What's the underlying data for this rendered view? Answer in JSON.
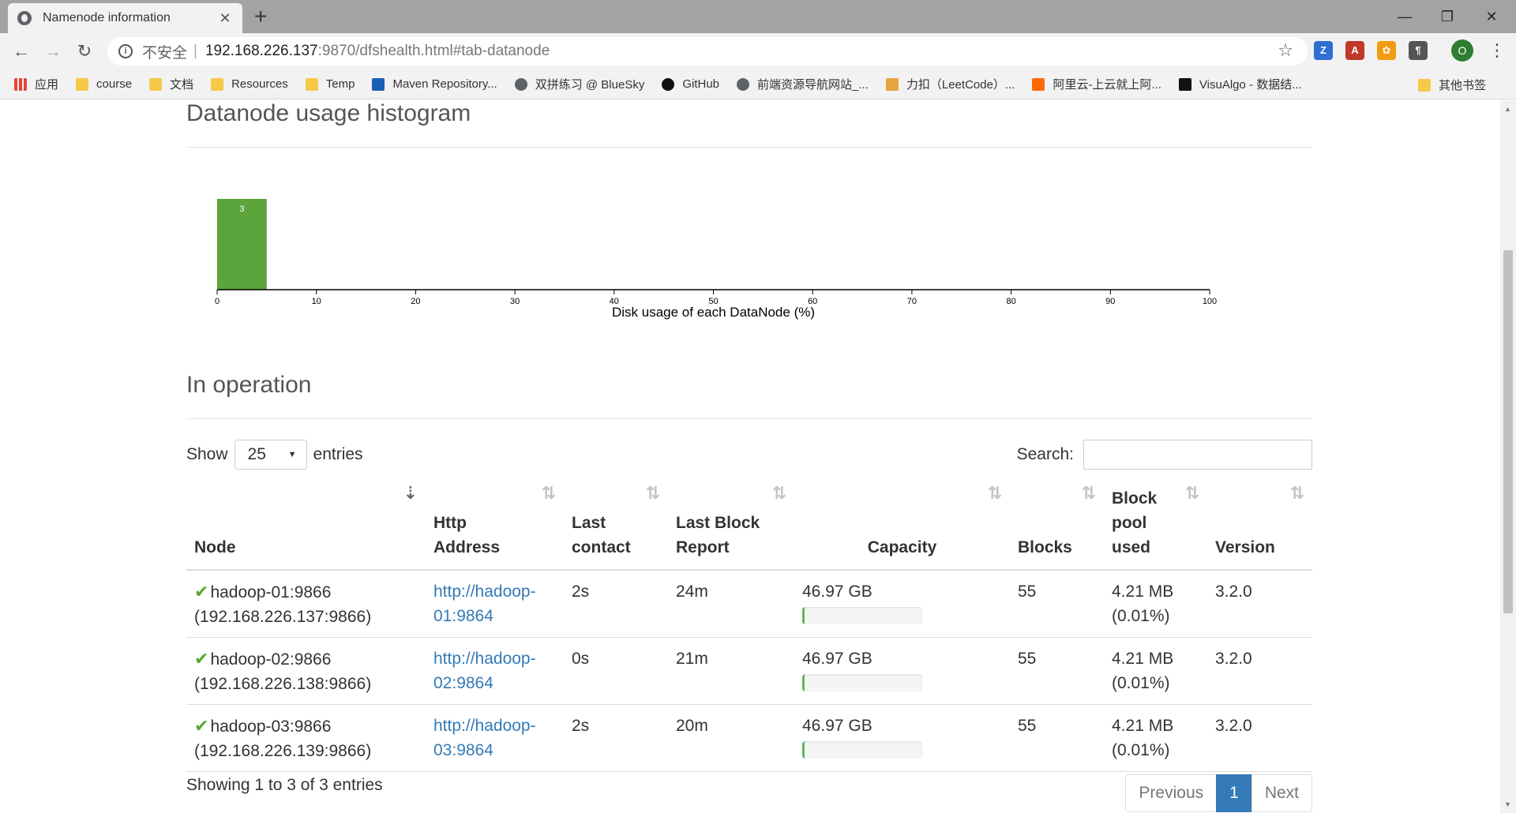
{
  "browser": {
    "tab_title": "Namenode information",
    "address": {
      "insecure_label": "不安全",
      "host": "192.168.226.137",
      "rest": ":9870/dfshealth.html#tab-datanode"
    },
    "profile_initial": "O",
    "bookmarks": [
      {
        "label": "应用",
        "icon": "apps-icon"
      },
      {
        "label": "course",
        "icon": "folder-icon"
      },
      {
        "label": "文档",
        "icon": "folder-icon"
      },
      {
        "label": "Resources",
        "icon": "folder-icon"
      },
      {
        "label": "Temp",
        "icon": "folder-icon"
      },
      {
        "label": "Maven Repository...",
        "icon": "maven-icon"
      },
      {
        "label": "双拼练习 @ BlueSky",
        "icon": "globe-icon"
      },
      {
        "label": "GitHub",
        "icon": "github-icon"
      },
      {
        "label": "前端资源导航网站_...",
        "icon": "globe-icon"
      },
      {
        "label": "力扣（LeetCode）...",
        "icon": "leetcode-icon"
      },
      {
        "label": "阿里云-上云就上阿...",
        "icon": "aliyun-icon"
      },
      {
        "label": "VisuAlgo - 数据结...",
        "icon": "visualgo-icon"
      }
    ],
    "other_bookmarks": "其他书签"
  },
  "histogram": {
    "title": "Datanode usage histogram",
    "chart_data": {
      "type": "bar",
      "title": "Datanode usage histogram",
      "xlabel": "Disk usage of each DataNode (%)",
      "ylabel": "",
      "bins": [
        {
          "from": 0,
          "to": 5,
          "count": 3
        }
      ],
      "xlim": [
        0,
        100
      ],
      "xticks": [
        0,
        10,
        20,
        30,
        40,
        50,
        60,
        70,
        80,
        90,
        100
      ],
      "bar_color": "#5ca43c",
      "grid": false
    }
  },
  "operation": {
    "title": "In operation",
    "show_label": "Show",
    "page_size": "25",
    "entries_label": "entries",
    "search_label": "Search:",
    "columns": {
      "node": "Node",
      "http1": "Http",
      "http2": "Address",
      "contact1": "Last",
      "contact2": "contact",
      "report1": "Last Block",
      "report2": "Report",
      "capacity": "Capacity",
      "blocks": "Blocks",
      "pool1": "Block",
      "pool2": "pool",
      "pool3": "used",
      "version": "Version"
    },
    "rows": [
      {
        "node": "hadoop-01:9866",
        "ip": "(192.168.226.137:9866)",
        "http1": "http://hadoop-",
        "http2": "01:9864",
        "contact": "2s",
        "report": "24m",
        "capacity": "46.97 GB",
        "used_pct": 1,
        "blocks": "55",
        "pool1": "4.21 MB",
        "pool2": "(0.01%)",
        "version": "3.2.0"
      },
      {
        "node": "hadoop-02:9866",
        "ip": "(192.168.226.138:9866)",
        "http1": "http://hadoop-",
        "http2": "02:9864",
        "contact": "0s",
        "report": "21m",
        "capacity": "46.97 GB",
        "used_pct": 1,
        "blocks": "55",
        "pool1": "4.21 MB",
        "pool2": "(0.01%)",
        "version": "3.2.0"
      },
      {
        "node": "hadoop-03:9866",
        "ip": "(192.168.226.139:9866)",
        "http1": "http://hadoop-",
        "http2": "03:9864",
        "contact": "2s",
        "report": "20m",
        "capacity": "46.97 GB",
        "used_pct": 1,
        "blocks": "55",
        "pool1": "4.21 MB",
        "pool2": "(0.01%)",
        "version": "3.2.0"
      }
    ],
    "info": "Showing 1 to 3 of 3 entries",
    "pager": {
      "previous": "Previous",
      "current": "1",
      "next": "Next"
    }
  }
}
